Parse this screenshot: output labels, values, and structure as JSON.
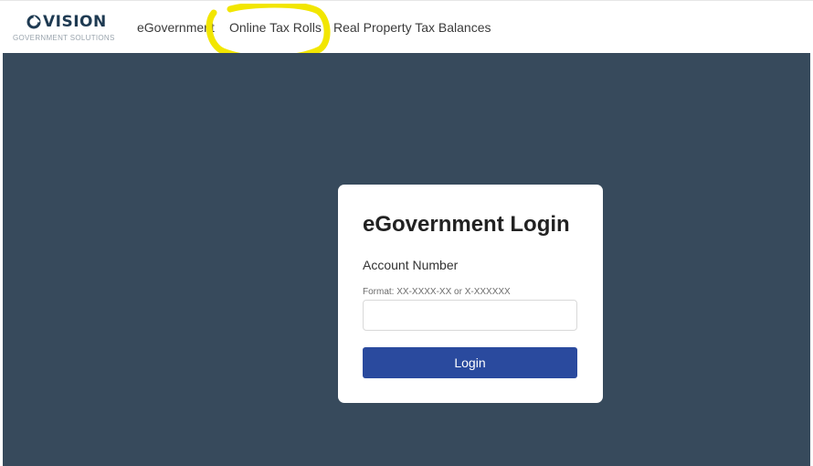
{
  "brand": {
    "logo_word": "VISION",
    "logo_subtitle": "GOVERNMENT SOLUTIONS",
    "logo_color": "#1e3a52"
  },
  "nav": {
    "items": [
      {
        "label": "eGovernment"
      },
      {
        "label": "Online Tax Rolls",
        "highlighted": true
      },
      {
        "label": "Real Property Tax Balances"
      }
    ],
    "highlight_color": "#f2e600"
  },
  "login": {
    "title": "eGovernment Login",
    "account_label": "Account Number",
    "format_hint": "Format: XX-XXXX-XX or X-XXXXXX",
    "account_value": "",
    "button_label": "Login"
  },
  "colors": {
    "background": "#374a5c",
    "button": "#2a4a9e",
    "card": "#ffffff"
  }
}
